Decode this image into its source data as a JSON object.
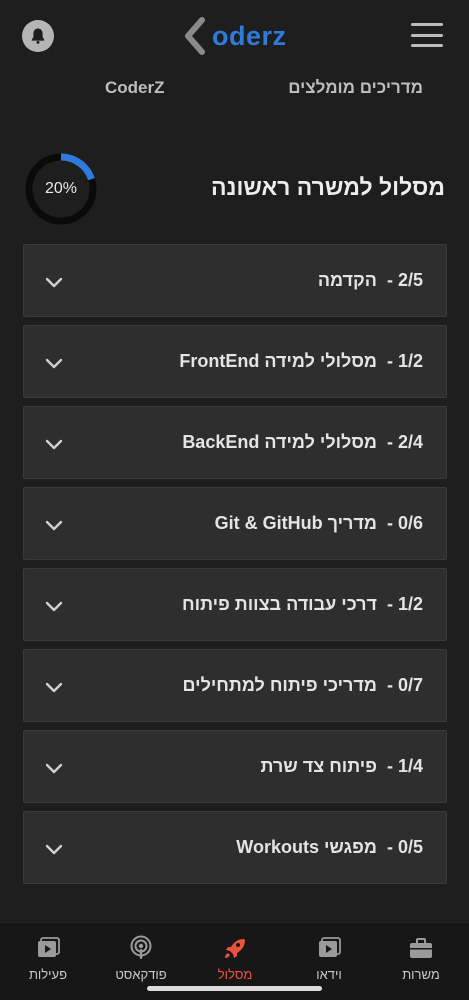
{
  "header": {
    "logo_text": "oderz",
    "logo_color": "#2f7bdc",
    "bell_icon": "bell-icon",
    "menu_icon": "hamburger-menu-icon"
  },
  "subnav": {
    "left_link": "CoderZ",
    "right_link": "מדריכים מומלצים"
  },
  "track": {
    "title": "מסלול למשרה ראשונה",
    "progress_label": "20%",
    "progress_value": 0.2,
    "progress_color": "#2f7bdc"
  },
  "sections": [
    {
      "count": "2/5",
      "title": "הקדמה"
    },
    {
      "count": "1/2",
      "title": "מסלולי למידה FrontEnd"
    },
    {
      "count": "2/4",
      "title": "מסלולי למידה BackEnd"
    },
    {
      "count": "0/6",
      "title": "מדריך Git & GitHub"
    },
    {
      "count": "1/2",
      "title": "דרכי עבודה בצוות פיתוח"
    },
    {
      "count": "0/7",
      "title": "מדריכי פיתוח למתחילים"
    },
    {
      "count": "1/4",
      "title": "פיתוח צד שרת"
    },
    {
      "count": "0/5",
      "title": "מפגשי Workouts"
    }
  ],
  "tabs": [
    {
      "label": "משרות",
      "icon": "briefcase-icon"
    },
    {
      "label": "וידאו",
      "icon": "video-icon"
    },
    {
      "label": "מסלול",
      "icon": "rocket-icon",
      "active": true
    },
    {
      "label": "פודקאסט",
      "icon": "podcast-icon"
    },
    {
      "label": "פעילות",
      "icon": "activity-icon"
    }
  ],
  "colors": {
    "background": "#1e1e1e",
    "card": "#2e2e2e",
    "active_tab": "#e8533f"
  }
}
